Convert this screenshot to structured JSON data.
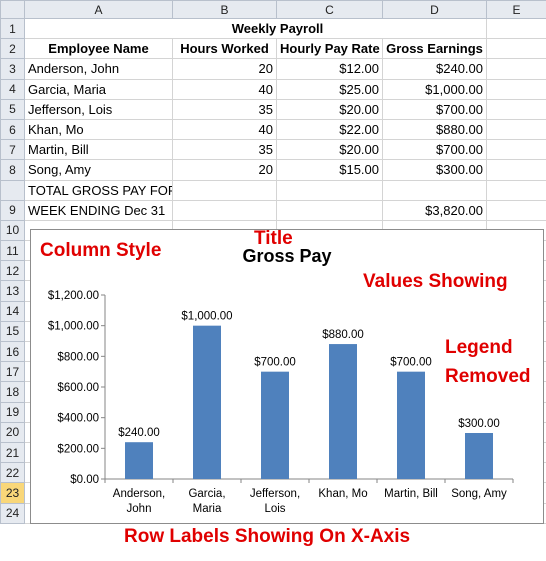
{
  "sheet": {
    "columns": [
      "A",
      "B",
      "C",
      "D",
      "E"
    ],
    "title": "Weekly Payroll",
    "headers": [
      "Employee Name",
      "Hours Worked",
      "Hourly Pay Rate",
      "Gross Earnings"
    ],
    "rows": [
      {
        "name": "Anderson, John",
        "hours": "20",
        "rate": "$12.00",
        "gross": "$240.00"
      },
      {
        "name": "Garcia, Maria",
        "hours": "40",
        "rate": "$25.00",
        "gross": "$1,000.00"
      },
      {
        "name": "Jefferson, Lois",
        "hours": "35",
        "rate": "$20.00",
        "gross": "$700.00"
      },
      {
        "name": "Khan, Mo",
        "hours": "40",
        "rate": "$22.00",
        "gross": "$880.00"
      },
      {
        "name": "Martin, Bill",
        "hours": "35",
        "rate": "$20.00",
        "gross": "$700.00"
      },
      {
        "name": "Song, Amy",
        "hours": "20",
        "rate": "$15.00",
        "gross": "$300.00"
      }
    ],
    "total_label_line1": "TOTAL GROSS PAY FOR",
    "total_label_line2": "WEEK ENDING Dec 31",
    "total_value": "$3,820.00",
    "row_numbers": [
      "1",
      "2",
      "3",
      "4",
      "5",
      "6",
      "7",
      "8",
      "9",
      "10",
      "11",
      "12",
      "13",
      "14",
      "15",
      "16",
      "17",
      "18",
      "19",
      "20",
      "21",
      "22",
      "23",
      "24"
    ]
  },
  "annotations": {
    "column_style": "Column Style",
    "title": "Title",
    "values_showing": "Values Showing",
    "legend_line1": "Legend",
    "legend_line2": "Removed",
    "row_labels": "Row Labels Showing On X-Axis"
  },
  "colors": {
    "bar": "#4f81bd",
    "annotation": "#e00000"
  },
  "chart_data": {
    "type": "bar",
    "title": "Gross Pay",
    "categories": [
      [
        "Anderson,",
        "John"
      ],
      [
        "Garcia,",
        "Maria"
      ],
      [
        "Jefferson,",
        "Lois"
      ],
      [
        "Khan, Mo"
      ],
      [
        "Martin, Bill"
      ],
      [
        "Song, Amy"
      ]
    ],
    "values": [
      240,
      1000,
      700,
      880,
      700,
      300
    ],
    "data_labels": [
      "$240.00",
      "$1,000.00",
      "$700.00",
      "$880.00",
      "$700.00",
      "$300.00"
    ],
    "y_ticks": [
      "$0.00",
      "$200.00",
      "$400.00",
      "$600.00",
      "$800.00",
      "$1,000.00",
      "$1,200.00"
    ],
    "ylim": [
      0,
      1200
    ],
    "grid": false,
    "legend": "none"
  }
}
